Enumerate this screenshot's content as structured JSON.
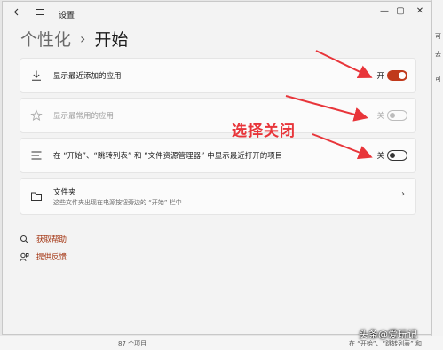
{
  "window": {
    "title": "设置",
    "minimize_glyph": "—",
    "maximize_glyph": "▢",
    "close_glyph": "✕"
  },
  "breadcrumb": {
    "parent": "个性化",
    "separator": "›",
    "current": "开始"
  },
  "settings": {
    "recently_added": {
      "icon": "download-icon",
      "label": "显示最近添加的应用",
      "state": "开",
      "on": true
    },
    "most_used": {
      "icon": "star-icon",
      "label": "显示最常用的应用",
      "state": "关",
      "on": false,
      "disabled": true
    },
    "recent_items": {
      "icon": "list-icon",
      "label": "在 “开始”、“跳转列表” 和 “文件资源管理器” 中显示最近打开的项目",
      "state": "关",
      "on": false
    },
    "folders": {
      "icon": "folder-icon",
      "label": "文件夹",
      "sublabel": "这些文件夹出现在电源按钮旁边的 “开始” 栏中"
    }
  },
  "links": {
    "help": {
      "icon": "help-icon",
      "label": "获取帮助"
    },
    "feedback": {
      "icon": "feedback-icon",
      "label": "提供反馈"
    }
  },
  "annotation": {
    "text": "选择关闭",
    "color": "#e8353a"
  },
  "watermark": "头条@爱玩记",
  "background": {
    "right_glyphs": [
      "可",
      "去",
      "可"
    ],
    "bottom_texts": [
      "87 个项目",
      "在 “开始”、“跳转列表” 和"
    ]
  },
  "colors": {
    "toggle_on": "#c0391b",
    "link": "#a33310",
    "window_bg": "#f3f3f3",
    "card_bg": "#fbfbfb"
  }
}
